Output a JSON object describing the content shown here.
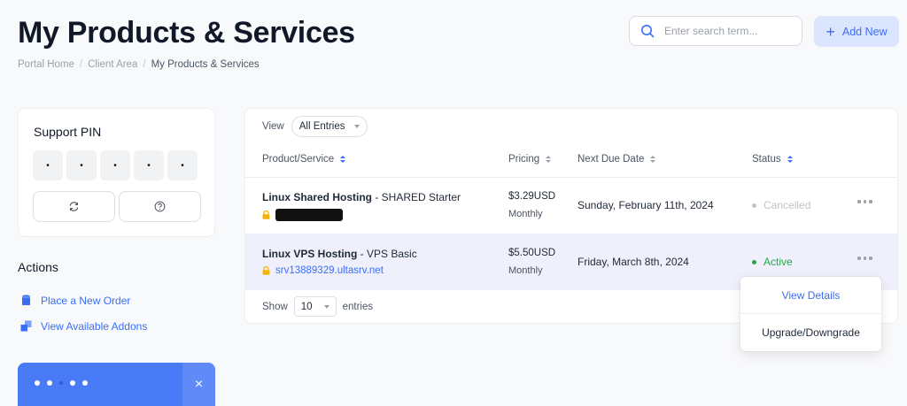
{
  "header": {
    "title": "My Products & Services",
    "breadcrumb": [
      "Portal Home",
      "Client Area",
      "My Products & Services"
    ],
    "search_placeholder": "Enter search term...",
    "add_new_label": "Add New"
  },
  "sidebar": {
    "support_pin": {
      "title": "Support PIN",
      "digits": [
        "•",
        "•",
        "•",
        "•",
        "•"
      ]
    },
    "actions": {
      "title": "Actions",
      "items": [
        {
          "label": "Place a New Order",
          "icon": "shopping-bag-icon"
        },
        {
          "label": "View Available Addons",
          "icon": "addons-icon"
        }
      ]
    },
    "slider_close": "×"
  },
  "table": {
    "view_label": "View",
    "view_selected": "All Entries",
    "columns": [
      "Product/Service",
      "Pricing",
      "Next Due Date",
      "Status"
    ],
    "rows": [
      {
        "product": "Linux Shared Hosting",
        "plan": " - SHARED Starter",
        "domain": "",
        "price": "$3.29USD",
        "cycle": "Monthly",
        "due": "Sunday, February 11th, 2024",
        "status": "Cancelled",
        "status_color": "#bfc3c9"
      },
      {
        "product": "Linux VPS Hosting",
        "plan": " - VPS Basic",
        "domain": "srv13889329.ultasrv.net",
        "price": "$5.50USD",
        "cycle": "Monthly",
        "due": "Friday, March 8th, 2024",
        "status": "Active",
        "status_color": "#22a745"
      }
    ],
    "show_label": "Show",
    "show_selected": "10",
    "entries_label": "entries"
  },
  "dropdown_menu": {
    "items": [
      "View Details",
      "Upgrade/Downgrade"
    ]
  },
  "colors": {
    "accent": "#3b6ef5",
    "active": "#22a745",
    "cancelled": "#bfc3c9"
  }
}
